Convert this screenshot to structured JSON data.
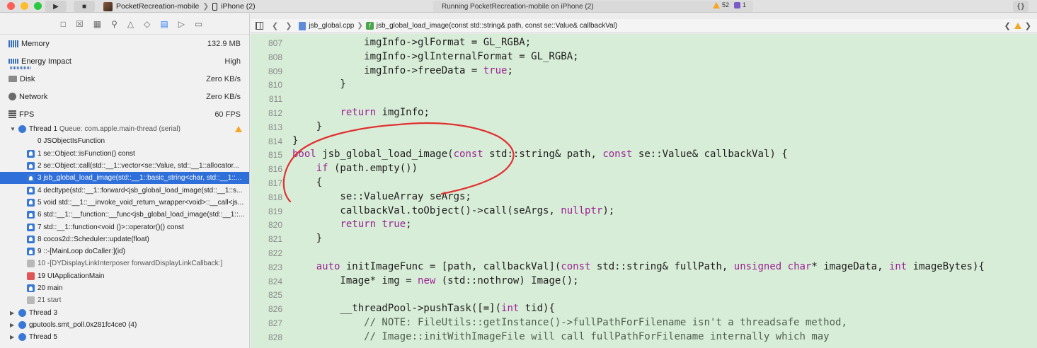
{
  "titlebar": {
    "scheme_app": "PocketRecreation-mobile",
    "scheme_device": "iPhone (2)",
    "status": "Running PocketRecreation-mobile on iPhone (2)",
    "warnings": "52",
    "issues": "1",
    "code_review": "{}"
  },
  "navigator": {
    "gauges": [
      {
        "name": "Memory",
        "value": "132.9 MB"
      },
      {
        "name": "Energy Impact",
        "value": "High"
      },
      {
        "name": "Disk",
        "value": "Zero KB/s"
      },
      {
        "name": "Network",
        "value": "Zero KB/s"
      },
      {
        "name": "FPS",
        "value": "60 FPS"
      }
    ],
    "thread1": {
      "name": "Thread 1",
      "queue": "Queue: com.apple.main-thread (serial)"
    },
    "frames": [
      {
        "label": "0 JSObjectIsFunction",
        "icon": "none"
      },
      {
        "label": "1 se::Object::isFunction() const",
        "icon": "blue"
      },
      {
        "label": "2 se::Object::call(std::__1::vector<se::Value, std::__1::allocator...",
        "icon": "blue"
      },
      {
        "label": "3 jsb_global_load_image(std::__1::basic_string<char, std::__1::...",
        "icon": "blue"
      },
      {
        "label": "4 decltype(std::__1::forward<jsb_global_load_image(std::__1::s...",
        "icon": "blue"
      },
      {
        "label": "5 void std::__1::__invoke_void_return_wrapper<void>::__call<js...",
        "icon": "blue"
      },
      {
        "label": "6 std::__1::__function::__func<jsb_global_load_image(std::__1::...",
        "icon": "blue"
      },
      {
        "label": "7 std::__1::function<void ()>::operator()() const",
        "icon": "blue"
      },
      {
        "label": "8 cocos2d::Scheduler::update(float)",
        "icon": "blue"
      },
      {
        "label": "9 ::-[MainLoop doCaller:](id)",
        "icon": "blue"
      },
      {
        "label": "10 -[DYDisplayLinkInterposer forwardDisplayLinkCallback:]",
        "icon": "grey"
      },
      {
        "label": "19 UIApplicationMain",
        "icon": "app"
      },
      {
        "label": "20 main",
        "icon": "blue"
      },
      {
        "label": "21 start",
        "icon": "grey"
      }
    ],
    "other_threads": [
      "Thread 3",
      "gputools.smt_poll.0x281fc4ce0 (4)",
      "Thread 5"
    ]
  },
  "editor": {
    "file": "jsb_global.cpp",
    "function": "jsb_global_load_image(const std::string& path, const se::Value& callbackVal)",
    "lines": [
      {
        "n": "807",
        "code": "            imgInfo->glFormat = GL_RGBA;"
      },
      {
        "n": "808",
        "code": "            imgInfo->glInternalFormat = GL_RGBA;"
      },
      {
        "n": "809",
        "code": "            imgInfo->freeData = true;"
      },
      {
        "n": "810",
        "code": "        }"
      },
      {
        "n": "811",
        "code": ""
      },
      {
        "n": "812",
        "code": "        return imgInfo;"
      },
      {
        "n": "813",
        "code": "    }"
      },
      {
        "n": "814",
        "code": "}"
      },
      {
        "n": "815",
        "code": "bool jsb_global_load_image(const std::string& path, const se::Value& callbackVal) {"
      },
      {
        "n": "816",
        "code": "    if (path.empty())"
      },
      {
        "n": "817",
        "code": "    {"
      },
      {
        "n": "818",
        "code": "        se::ValueArray seArgs;"
      },
      {
        "n": "819",
        "code": "        callbackVal.toObject()->call(seArgs, nullptr);"
      },
      {
        "n": "820",
        "code": "        return true;"
      },
      {
        "n": "821",
        "code": "    }"
      },
      {
        "n": "822",
        "code": ""
      },
      {
        "n": "823",
        "code": "    auto initImageFunc = [path, callbackVal](const std::string& fullPath, unsigned char* imageData, int imageBytes){"
      },
      {
        "n": "824",
        "code": "        Image* img = new (std::nothrow) Image();"
      },
      {
        "n": "825",
        "code": ""
      },
      {
        "n": "826",
        "code": "        __threadPool->pushTask([=](int tid){"
      },
      {
        "n": "827",
        "code": "            // NOTE: FileUtils::getInstance()->fullPathForFilename isn't a threadsafe method,"
      },
      {
        "n": "828",
        "code": "            // Image::initWithImageFile will call fullPathForFilename internally which may"
      }
    ]
  },
  "colors": {
    "editor_bg": "#d8edd8",
    "keyword": "#9b2393",
    "selection": "#2f6fd9",
    "annotation": "#e03030"
  }
}
